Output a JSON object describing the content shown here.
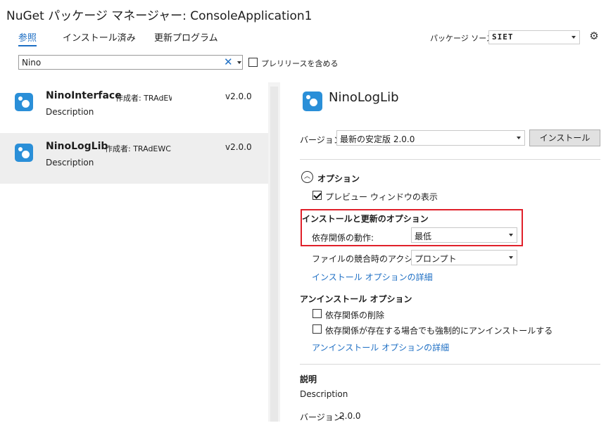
{
  "window": {
    "title": "NuGet パッケージ マネージャー: ConsoleApplication1"
  },
  "tabs": [
    {
      "label": "参照",
      "active": true
    },
    {
      "label": "インストール済み",
      "active": false
    },
    {
      "label": "更新プログラム",
      "active": false
    }
  ],
  "package_source": {
    "label": "パッケージ ソース:",
    "value": "SIET"
  },
  "search": {
    "value": "Nino",
    "clear_glyph": "✕",
    "prerelease_label": "プレリリースを含める",
    "prerelease_checked": false
  },
  "packages": [
    {
      "name": "NinoInterface",
      "author": "作成者: TRAdEWC",
      "version": "v2.0.0",
      "description": "Description",
      "selected": false
    },
    {
      "name": "NinoLogLib",
      "author": "作成者: TRAdEWC",
      "version": "v2.0.0",
      "description": "Description",
      "selected": true
    }
  ],
  "detail": {
    "title": "NinoLogLib",
    "version_label": "バージョン:",
    "version_value": "最新の安定版 2.0.0",
    "install_button": "インストール",
    "options_header": "オプション",
    "preview_label": "プレビュー ウィンドウの表示",
    "preview_checked": true,
    "install_update_header": "インストールと更新のオプション",
    "dependency_label": "依存関係の動作:",
    "dependency_value": "最低",
    "file_conflict_label": "ファイルの競合時のアクション:",
    "file_conflict_value": "プロンプト",
    "install_options_link": "インストール オプションの詳細",
    "uninstall_header": "アンインストール オプション",
    "remove_deps_label": "依存関係の削除",
    "force_uninstall_label": "依存関係が存在する場合でも強制的にアンインストールする",
    "uninstall_options_link": "アンインストール オプションの詳細",
    "description_header": "説明",
    "description_value": "Description",
    "version_footer_label": "バージョン:",
    "version_footer_value": "2.0.0"
  },
  "colors": {
    "accent": "#1e6fc4",
    "highlight_box": "#e0202a",
    "selected_row": "#eeeeee"
  }
}
